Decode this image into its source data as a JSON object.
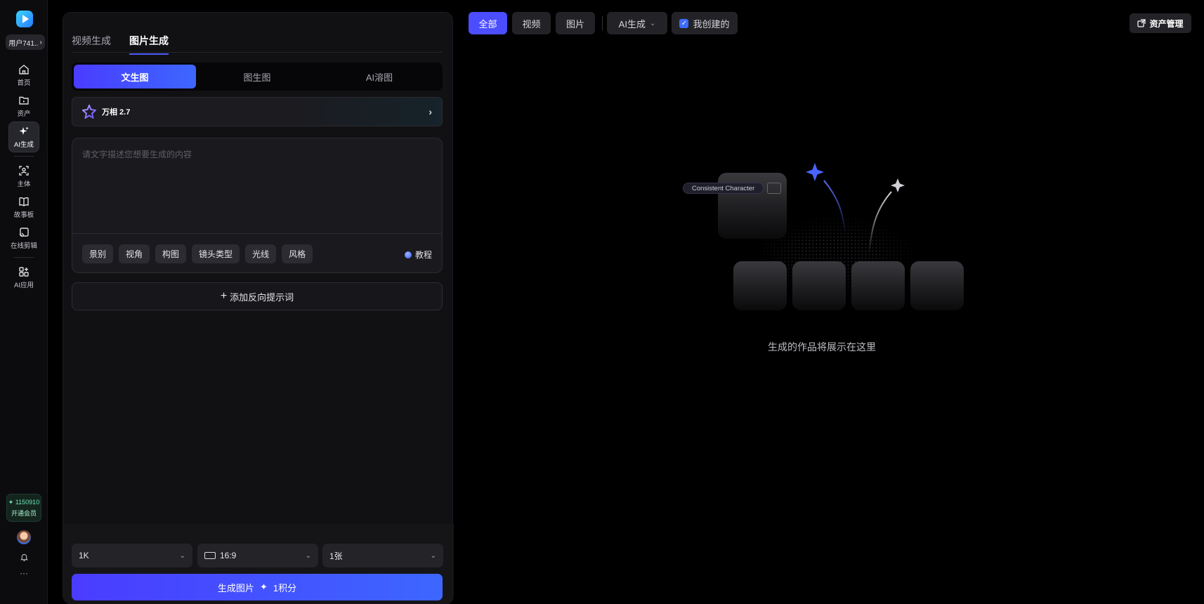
{
  "rail": {
    "user_label": "用户741..",
    "nav": [
      {
        "label": "首页"
      },
      {
        "label": "资产"
      },
      {
        "label": "AI生成"
      },
      {
        "label": "主体"
      },
      {
        "label": "故事板"
      },
      {
        "label": "在线剪辑"
      },
      {
        "label": "AI应用"
      }
    ],
    "credits_value": "1150910",
    "credits_action": "开通会员",
    "more_label": "···"
  },
  "panel": {
    "tabs": [
      {
        "label": "视频生成"
      },
      {
        "label": "图片生成"
      }
    ],
    "modes": [
      {
        "label": "文生图"
      },
      {
        "label": "图生图"
      },
      {
        "label": "AI溶图"
      }
    ],
    "model_name": "万相 2.7",
    "prompt": {
      "placeholder": "请文字描述您想要生成的内容",
      "value": ""
    },
    "chips": [
      {
        "label": "景别"
      },
      {
        "label": "视角"
      },
      {
        "label": "构图"
      },
      {
        "label": "镜头类型"
      },
      {
        "label": "光线"
      },
      {
        "label": "风格"
      }
    ],
    "tutorial_label": "教程",
    "negative_prompt_label": "添加反向提示词",
    "resolution": "1K",
    "ratio": "16:9",
    "count": "1张",
    "generate_label": "生成图片",
    "cost_label": "1积分"
  },
  "filters": {
    "all": "全部",
    "video": "视频",
    "image": "图片",
    "ai_gen": "AI生成",
    "mine": "我创建的",
    "asset_manage": "资产管理"
  },
  "empty_state": {
    "tag_label": "Consistent Character",
    "message": "生成的作品将展示在这里"
  },
  "colors": {
    "accent": "#4b4dff",
    "accent_gradient_end": "#3d67ff",
    "credits_green": "#6ee7b7"
  }
}
